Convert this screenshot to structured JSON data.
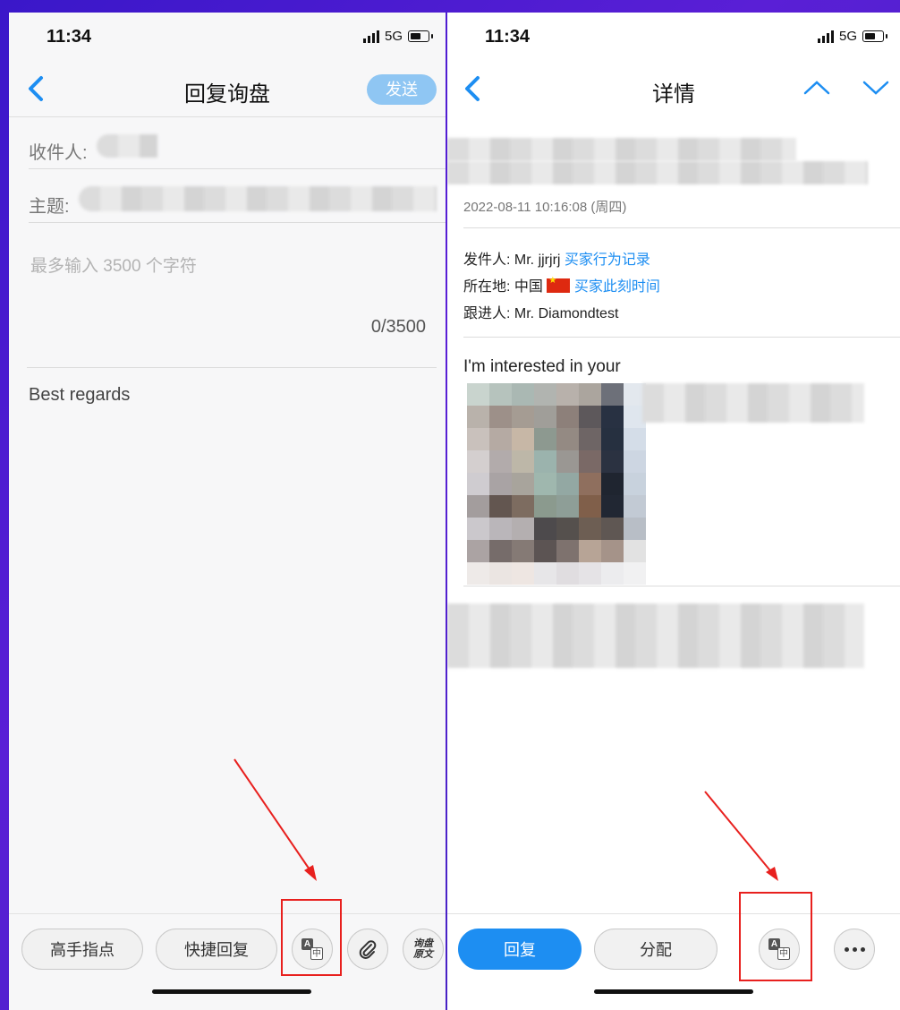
{
  "left": {
    "status": {
      "time": "11:34",
      "network": "5G"
    },
    "nav": {
      "title": "回复询盘",
      "send": "发送"
    },
    "recipient_label": "收件人:",
    "subject_label": "主题:",
    "body_placeholder": "最多输入 3500 个字符",
    "counter": "0/3500",
    "signature": "Best regards",
    "toolbar": {
      "tips": "高手指点",
      "quick_reply": "快捷回复",
      "translate_a": "A",
      "translate_zh": "中",
      "original_line1": "询盘",
      "original_line2": "原文"
    }
  },
  "right": {
    "status": {
      "time": "11:34",
      "network": "5G"
    },
    "nav": {
      "title": "详情"
    },
    "date": "2022-08-11 10:16:08 (周四)",
    "sender_label": "发件人: ",
    "sender_name": "Mr. jjrjrj",
    "sender_link": "买家行为记录",
    "location_label": "所在地: ",
    "location_value": "中国",
    "location_link": "买家此刻时间",
    "follower_label": "跟进人: ",
    "follower_name": "Mr. Diamondtest",
    "message": "I'm interested in your",
    "toolbar": {
      "reply": "回复",
      "assign": "分配",
      "translate_a": "A",
      "translate_zh": "中"
    }
  },
  "colors": {
    "accent": "#1d8ef2",
    "highlight": "#e8201e",
    "background": "#4a22c8"
  }
}
